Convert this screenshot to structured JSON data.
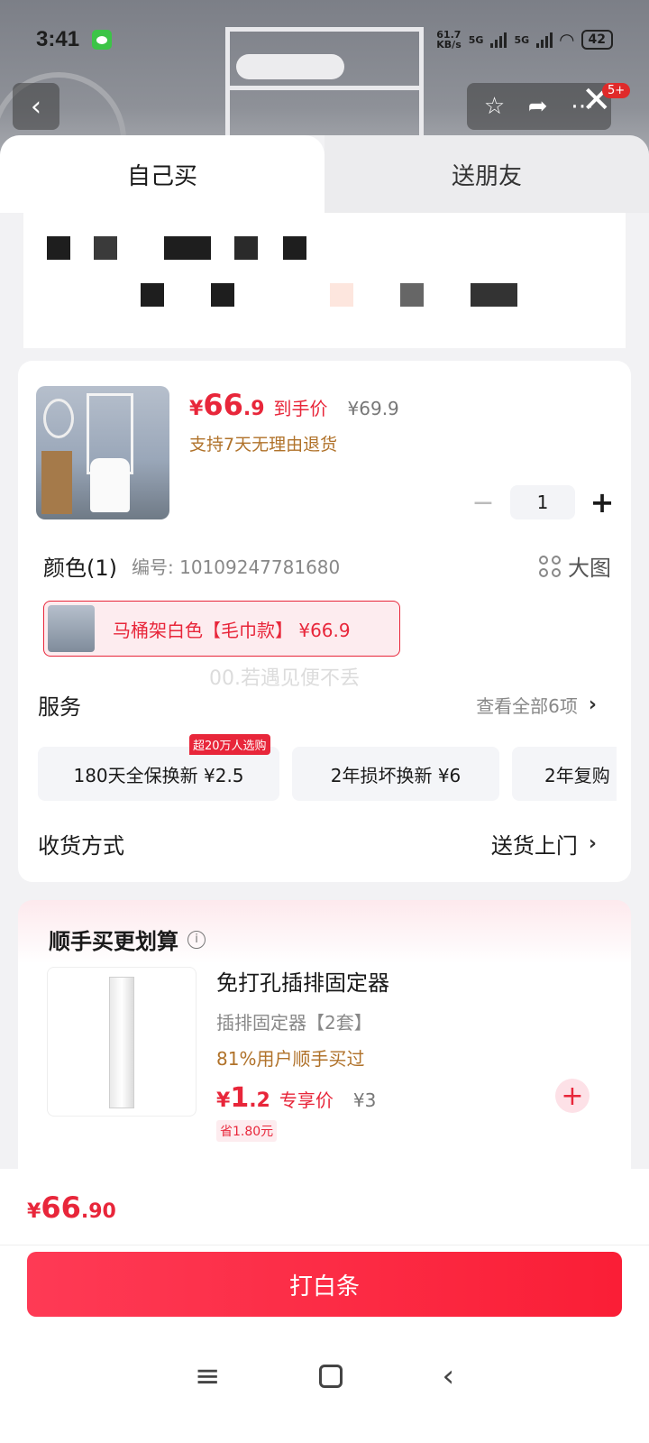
{
  "status_bar": {
    "time": "3:41",
    "speed_top": "61.7",
    "speed_bottom": "KB/s",
    "net1": "5G",
    "net2": "5G",
    "battery": "42"
  },
  "header": {
    "back_icon": "chevron-left-icon",
    "badge": "5+"
  },
  "tabs": [
    {
      "label": "自己买"
    },
    {
      "label": "送朋友"
    }
  ],
  "product": {
    "price_symbol": "¥",
    "price_int": "66",
    "price_dec": ".9",
    "price_label": "到手价",
    "original_price": "¥69.9",
    "return_policy": "支持7天无理由退货",
    "quantity": "1"
  },
  "color": {
    "title": "颜色(1)",
    "sku": "编号: 10109247781680",
    "big_image": "大图",
    "selected_variant": "马桶架白色【毛巾款】 ¥66.9"
  },
  "watermark": "00.若遇见便不丢",
  "service": {
    "label": "服务",
    "view_all": "查看全部6项",
    "hot_tag": "超20万人选购",
    "items": [
      {
        "label": "180天全保换新  ¥2.5"
      },
      {
        "label": "2年损坏换新  ¥6"
      },
      {
        "label": "2年复购"
      }
    ]
  },
  "delivery": {
    "label": "收货方式",
    "value": "送货上门"
  },
  "addon": {
    "title": "顺手买更划算",
    "name": "免打孔插排固定器",
    "spec": "插排固定器【2套】",
    "percent": "81%用户顺手买过",
    "price_symbol": "¥",
    "price_int": "1",
    "price_dec": ".2",
    "price_label": "专享价",
    "original_price": "¥3",
    "save": "省1.80元"
  },
  "footer": {
    "total_symbol": "¥",
    "total_int": "66",
    "total_dec": ".90",
    "cta": "打白条"
  },
  "colors": {
    "accent": "#e8263a",
    "gold": "#b0722a",
    "cta": "#fa1e36"
  }
}
